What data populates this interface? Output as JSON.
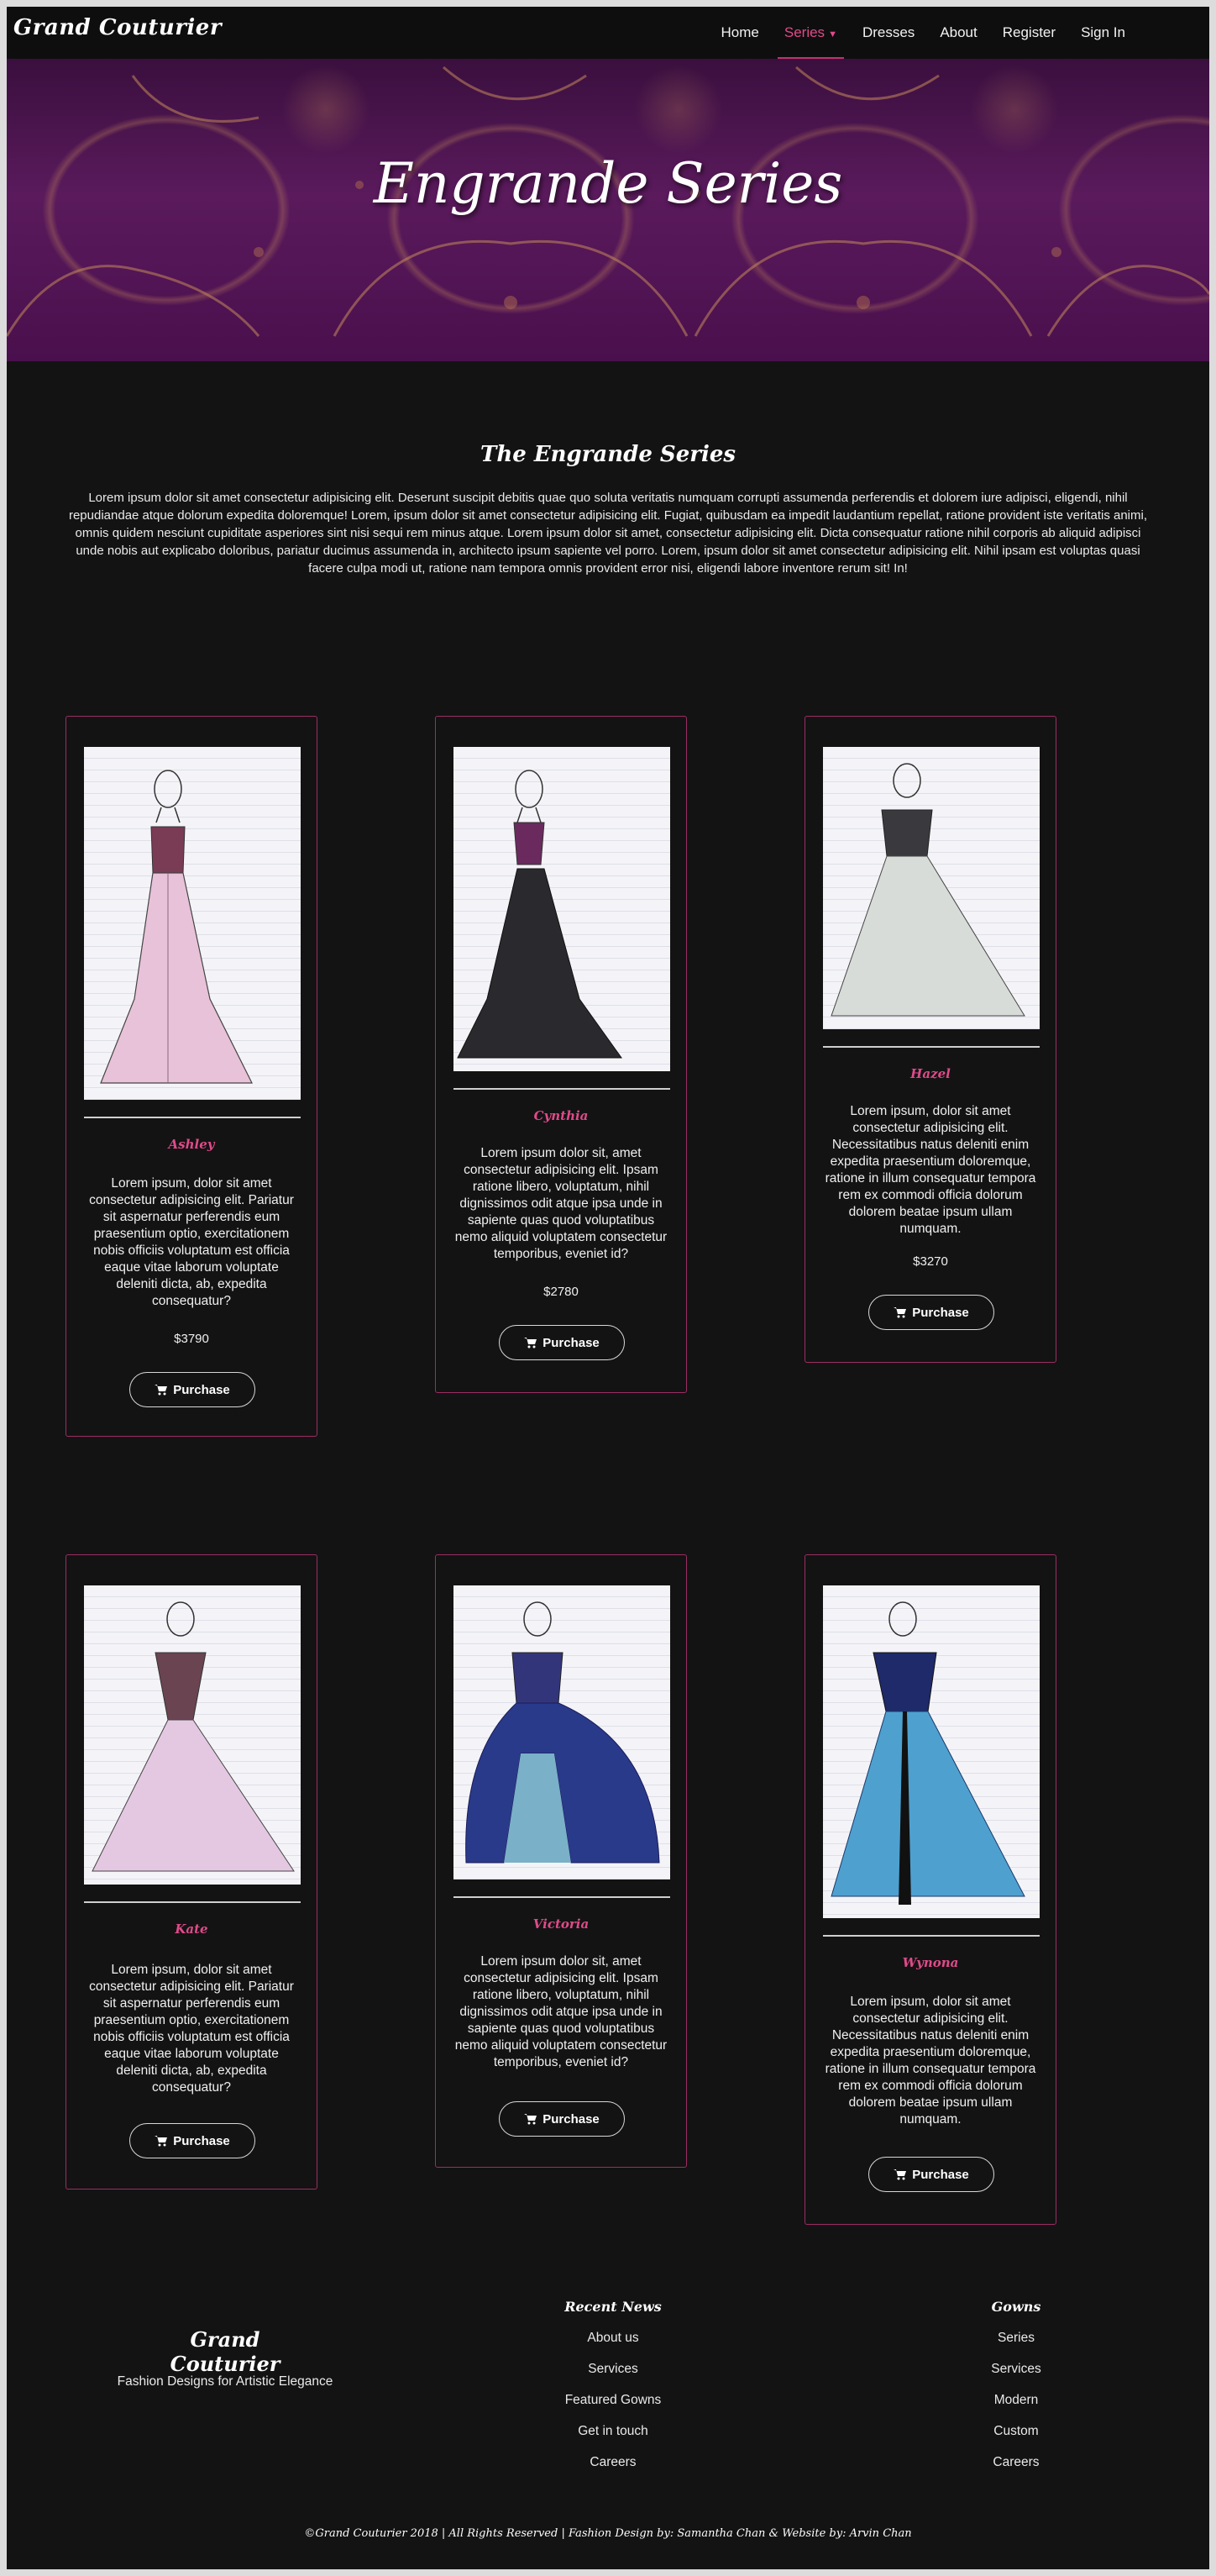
{
  "nav": {
    "brand": "Grand Couturier",
    "links": [
      {
        "label": "Home"
      },
      {
        "label": "Series"
      },
      {
        "label": "Dresses"
      },
      {
        "label": "About"
      },
      {
        "label": "Register"
      },
      {
        "label": "Sign In"
      }
    ],
    "active_color": "#e04a8a"
  },
  "hero": {
    "title": "Engrande Series"
  },
  "intro": {
    "title": "The Engrande Series",
    "text": "Lorem ipsum dolor sit amet consectetur adipisicing elit. Deserunt suscipit debitis quae quo soluta veritatis numquam corrupti assumenda perferendis et dolorem iure adipisci, eligendi, nihil repudiandae atque dolorum expedita doloremque! Lorem, ipsum dolor sit amet consectetur adipisicing elit. Fugiat, quibusdam ea impedit laudantium repellat, ratione provident iste veritatis animi, omnis quidem nesciunt cupiditate asperiores sint nisi sequi rem minus atque. Lorem ipsum dolor sit amet, consectetur adipisicing elit. Dicta consequatur ratione nihil corporis ab aliquid adipisci unde nobis aut explicabo doloribus, pariatur ducimus assumenda in, architecto ipsum sapiente vel porro. Lorem, ipsum dolor sit amet consectetur adipisicing elit. Nihil ipsam est voluptas quasi facere culpa modi ut, ratione nam tempora omnis provident error nisi, eligendi labore inventore rerum sit! In!"
  },
  "dresses": [
    {
      "name": "Ashley",
      "desc": "Lorem ipsum, dolor sit amet consectetur adipisicing elit. Pariatur sit aspernatur perferendis eum praesentium optio, exercitationem nobis officiis voluptatum est officia eaque vitae laborum voluptate deleniti dicta, ab, expedita consequatur?",
      "price": "$3790",
      "button": "Purchase"
    },
    {
      "name": "Cynthia",
      "desc": "Lorem ipsum dolor sit, amet consectetur adipisicing elit. Ipsam ratione libero, voluptatum, nihil dignissimos odit atque ipsa unde in sapiente quas quod voluptatibus nemo aliquid voluptatem consectetur temporibus, eveniet id?",
      "price": "$2780",
      "button": "Purchase"
    },
    {
      "name": "Hazel",
      "desc": "Lorem ipsum, dolor sit amet consectetur adipisicing elit. Necessitatibus natus deleniti enim expedita praesentium doloremque, ratione in illum consequatur tempora rem ex commodi officia dolorum dolorem beatae ipsum ullam numquam.",
      "price": "$3270",
      "button": "Purchase"
    },
    {
      "name": "Kate",
      "desc": "Lorem ipsum, dolor sit amet consectetur adipisicing elit. Pariatur sit aspernatur perferendis eum praesentium optio, exercitationem nobis officiis voluptatum est officia eaque vitae laborum voluptate deleniti dicta, ab, expedita consequatur?",
      "button": "Purchase"
    },
    {
      "name": "Victoria",
      "desc": "Lorem ipsum dolor sit, amet consectetur adipisicing elit. Ipsam ratione libero, voluptatum, nihil dignissimos odit atque ipsa unde in sapiente quas quod voluptatibus nemo aliquid voluptatem consectetur temporibus, eveniet id?",
      "button": "Purchase"
    },
    {
      "name": "Wynona",
      "desc": "Lorem ipsum, dolor sit amet consectetur adipisicing elit. Necessitatibus natus deleniti enim expedita praesentium doloremque, ratione in illum consequatur tempora rem ex commodi officia dolorum dolorem beatae ipsum ullam numquam.",
      "button": "Purchase"
    }
  ],
  "footer": {
    "brand": "Grand Couturier",
    "tagline": "Fashion Designs for Artistic Elegance",
    "col1": {
      "heading": "Recent News",
      "items": [
        "About us",
        "Services",
        "Featured Gowns",
        "Get in touch",
        "Careers"
      ]
    },
    "col2": {
      "heading": "Gowns",
      "items": [
        "Series",
        "Services",
        "Modern",
        "Custom",
        "Careers"
      ]
    },
    "copyright": "©Grand Couturier 2018 | All Rights Reserved | Fashion Design by: Samantha Chan & Website by: Arvin Chan"
  }
}
